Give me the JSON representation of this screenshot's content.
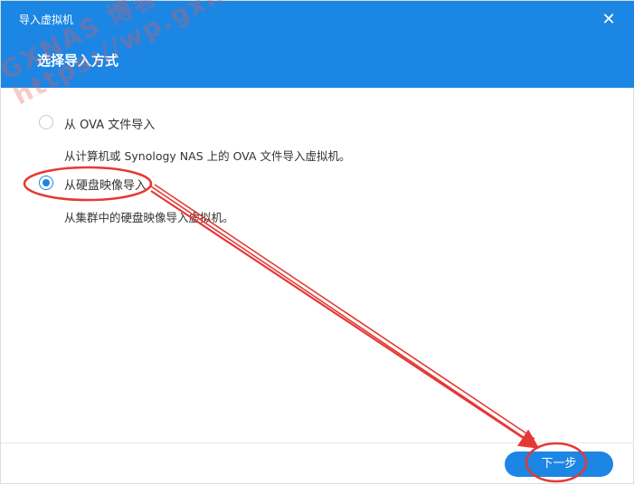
{
  "window": {
    "title": "导入虚拟机",
    "close_icon": "close-icon"
  },
  "step": {
    "title": "选择导入方式"
  },
  "watermark": {
    "line1": "GXNAS 博客",
    "line2": "https://wp.gxnas.com"
  },
  "options": [
    {
      "label": "从 OVA 文件导入",
      "description": "从计算机或 Synology NAS 上的 OVA 文件导入虚拟机。",
      "selected": false
    },
    {
      "label": "从硬盘映像导入",
      "description": "从集群中的硬盘映像导入虚拟机。",
      "selected": true
    }
  ],
  "footer": {
    "next_label": "下一步"
  },
  "colors": {
    "accent": "#1c86e4",
    "annotation": "#e53935"
  }
}
